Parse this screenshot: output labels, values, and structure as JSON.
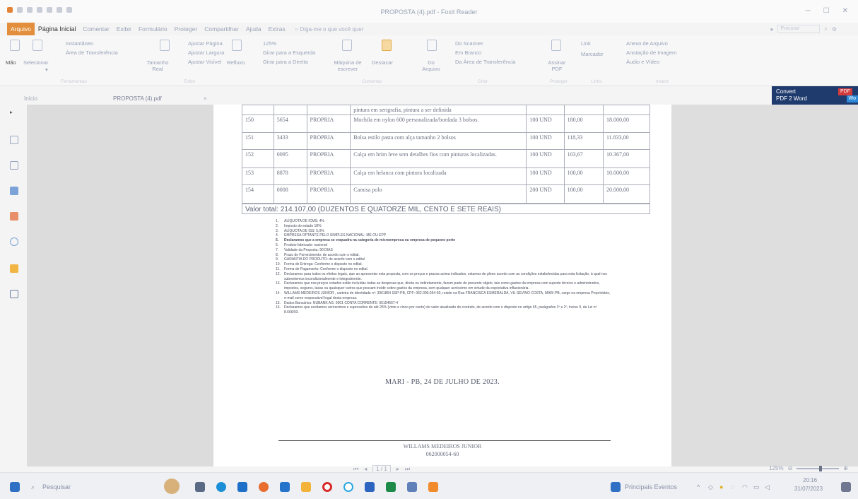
{
  "window": {
    "title": "PROPOSTA (4).pdf - Foxit Reader"
  },
  "ribbon_tabs": [
    "Arquivo",
    "Página Inicial",
    "Comentar",
    "Exibir",
    "Formulário",
    "Proteger",
    "Compartilhar",
    "Ajuda",
    "Extras"
  ],
  "ask_placeholder": "Diga-me o que você quer",
  "search_right": "Procurar",
  "ribbon": {
    "mao": "Mão",
    "selecionar": "Selecionar",
    "instantaneo": "Instantâneo",
    "area_transferencia": "Área de Transferência",
    "tamanho_real": "Tamanho Real",
    "ajustar_pagina": "Ajustar Página",
    "ajustar_largura": "Ajustar Largura",
    "ajustar_visivel": "Ajustar Visível",
    "zoom": "125%",
    "girar_esquerda": "Girar para a Esquerda",
    "girar_direita": "Girar para a Direita",
    "refluxo": "Refluxo",
    "maquina_escrever": "Máquina de escrever",
    "destacar": "Destacar",
    "do_arquivo": "Do Arquivo",
    "do_scanner": "Do Scanner",
    "em_branco": "Em Branco",
    "da_area": "Da Área de Transferência",
    "assinar_pdf": "Assinar PDF",
    "link": "Link",
    "marcador": "Marcador",
    "anexo": "Anexo de Arquivo",
    "anotacao_imagem": "Anotação de Imagem",
    "audio_video": "Áudio e Vídeo",
    "grp_ferramentas": "Ferramentas",
    "grp_exibir": "Exibir",
    "grp_comentar": "Comentar",
    "grp_criar": "Criar",
    "grp_proteger": "Proteger",
    "grp_links": "Links",
    "grp_inserir": "Inserir"
  },
  "doc_tabs": {
    "start": "Início",
    "current": "PROPOSTA (4).pdf",
    "close": "×"
  },
  "convert_banner": {
    "line1": "Convert",
    "line2": "PDF 2 Word",
    "pdf_badge": "PDF",
    "word_badge": "Wo"
  },
  "document": {
    "top_fragment": "pintura em serigrafia, pintura a ser definida",
    "rows": [
      {
        "item": "150",
        "code": "5654",
        "brand": "PROPRIA",
        "desc": "Mochila em nylon 600 personalizada/bordada 3 bolsos.",
        "unit": "100 UND",
        "price": "180,00",
        "total": "18.000,00"
      },
      {
        "item": "151",
        "code": "3433",
        "brand": "PROPRIA",
        "desc": "Bolsa estilo pasta com alça tamanho 2 bolsos",
        "unit": "100 UND",
        "price": "118,33",
        "total": "11.833,00"
      },
      {
        "item": "152",
        "code": "0095",
        "brand": "PROPRIA",
        "desc": "Calça em brim leve sem detalhes fios com pinturas localizadas.",
        "unit": "100 UND",
        "price": "103,67",
        "total": "10.367,00"
      },
      {
        "item": "153",
        "code": "8878",
        "brand": "PROPRIA",
        "desc": "Calça em helanca com pintura localizada",
        "unit": "100 UND",
        "price": "100,00",
        "total": "10.000,00"
      },
      {
        "item": "154",
        "code": "0008",
        "brand": "PROPRIA",
        "desc": "Camisa polo",
        "unit": "200 UND",
        "price": "100,00",
        "total": "20.000,00"
      }
    ],
    "total_line": "Valor total: 214.107,00 (DUZENTOS E QUATORZE MIL, CENTO E SETE REAIS)",
    "declarations": [
      {
        "n": "1.",
        "t": "ALÍQUOTA DE ICMS: 4%"
      },
      {
        "n": "2.",
        "t": "Imposto do estado 18%"
      },
      {
        "n": "3.",
        "t": "ALÍQUOTA DE ISS: 5,0%"
      },
      {
        "n": "4.",
        "t": "EMPRESA OPTANTE PELO SIMPLES NACIONAL: ME OU EPP"
      },
      {
        "n": "5.",
        "t": "Declaramos que a empresa se enquadra na categoria de microempresa ou empresa de pequeno porte"
      },
      {
        "n": "6.",
        "t": "Produto fabricado: nacional"
      },
      {
        "n": "7.",
        "t": "Validade da Proposta: 90 DIAS"
      },
      {
        "n": "8.",
        "t": "Prazo de Fornecimento: de acordo com o edital."
      },
      {
        "n": "9.",
        "t": "GARANTIA DO PRODUTO: de acordo com o edital"
      },
      {
        "n": "10.",
        "t": "Forma de Entrega: Conforme o disposto no edital."
      },
      {
        "n": "11.",
        "t": "Forma de Pagamento: Conforme o disposto no edital."
      },
      {
        "n": "12.",
        "t": "Declaramos para todos os efeitos legais, que ao apresentar esta proposta, com os preços e prazos acima indicados, estamos de pleno acordo com as condições estabelecidas para esta licitação, à qual nos submetemos incondicionalmente e integralmente."
      },
      {
        "n": "13.",
        "t": "Declaramos que nos preços cotados estão incluídas todas as despesas que, direta ou indiretamente, fazem parte do presente objeto, tais como gastos da empresa com suporte técnico e administrativo, impostos, seguros, taxas ou quaisquer outros que possam incidir sobre gastos da empresa, sem qualquer acréscimo em virtude da expectativa inflacionária."
      },
      {
        "n": "14.",
        "t": "WILLAMS MEDEIROS JÚNIOR , carteira de identidade nº: 3061864 SSP-PB, CPF: 062.000.054-60, reside na Rua FRANCISCA ESMERALDA, VIL SEVINO COSTA, MARI-PB, cargo na empresa Proprietário, e-mail como responsável legal desta empresa."
      },
      {
        "n": "15.",
        "t": "Dados Bancários: NUBANK AG: 0001 CONTA CORRENTE: 65154667-4"
      },
      {
        "n": "16.",
        "t": "Declaramos que aceitamos acréscimos e supressões de até 25% (vinte e cinco por cento) do valor atualizado do contrato, de acordo com o disposto no artigo 65, parágrafos 1º e 2º, inciso II, da Lei nº 8.666/93."
      }
    ],
    "place_date": "MARI - PB, 24 DE JULHO DE 2023.",
    "signature_name": "WILLAMS MEDEIROS JUNIOR",
    "signature_id": "062000054-60"
  },
  "status": {
    "page": "1 / 1",
    "zoom": "125%"
  },
  "taskbar": {
    "search": "Pesquisar",
    "principais": "Principais Eventos",
    "time": "20:16",
    "date": "31/07/2023"
  },
  "colors": {
    "file_tab": "#e28e3c",
    "convert_bg": "#1f3a6d",
    "pdf_badge": "#d23c3c"
  }
}
